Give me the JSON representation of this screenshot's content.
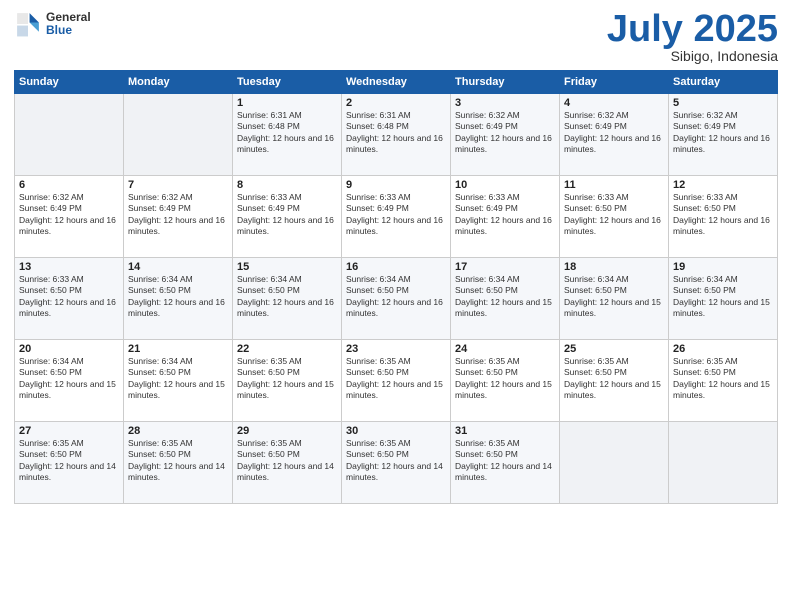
{
  "logo": {
    "general": "General",
    "blue": "Blue"
  },
  "title": "July 2025",
  "subtitle": "Sibigo, Indonesia",
  "days_of_week": [
    "Sunday",
    "Monday",
    "Tuesday",
    "Wednesday",
    "Thursday",
    "Friday",
    "Saturday"
  ],
  "weeks": [
    [
      {
        "day": "",
        "info": ""
      },
      {
        "day": "",
        "info": ""
      },
      {
        "day": "1",
        "info": "Sunrise: 6:31 AM\nSunset: 6:48 PM\nDaylight: 12 hours and 16 minutes."
      },
      {
        "day": "2",
        "info": "Sunrise: 6:31 AM\nSunset: 6:48 PM\nDaylight: 12 hours and 16 minutes."
      },
      {
        "day": "3",
        "info": "Sunrise: 6:32 AM\nSunset: 6:49 PM\nDaylight: 12 hours and 16 minutes."
      },
      {
        "day": "4",
        "info": "Sunrise: 6:32 AM\nSunset: 6:49 PM\nDaylight: 12 hours and 16 minutes."
      },
      {
        "day": "5",
        "info": "Sunrise: 6:32 AM\nSunset: 6:49 PM\nDaylight: 12 hours and 16 minutes."
      }
    ],
    [
      {
        "day": "6",
        "info": "Sunrise: 6:32 AM\nSunset: 6:49 PM\nDaylight: 12 hours and 16 minutes."
      },
      {
        "day": "7",
        "info": "Sunrise: 6:32 AM\nSunset: 6:49 PM\nDaylight: 12 hours and 16 minutes."
      },
      {
        "day": "8",
        "info": "Sunrise: 6:33 AM\nSunset: 6:49 PM\nDaylight: 12 hours and 16 minutes."
      },
      {
        "day": "9",
        "info": "Sunrise: 6:33 AM\nSunset: 6:49 PM\nDaylight: 12 hours and 16 minutes."
      },
      {
        "day": "10",
        "info": "Sunrise: 6:33 AM\nSunset: 6:49 PM\nDaylight: 12 hours and 16 minutes."
      },
      {
        "day": "11",
        "info": "Sunrise: 6:33 AM\nSunset: 6:50 PM\nDaylight: 12 hours and 16 minutes."
      },
      {
        "day": "12",
        "info": "Sunrise: 6:33 AM\nSunset: 6:50 PM\nDaylight: 12 hours and 16 minutes."
      }
    ],
    [
      {
        "day": "13",
        "info": "Sunrise: 6:33 AM\nSunset: 6:50 PM\nDaylight: 12 hours and 16 minutes."
      },
      {
        "day": "14",
        "info": "Sunrise: 6:34 AM\nSunset: 6:50 PM\nDaylight: 12 hours and 16 minutes."
      },
      {
        "day": "15",
        "info": "Sunrise: 6:34 AM\nSunset: 6:50 PM\nDaylight: 12 hours and 16 minutes."
      },
      {
        "day": "16",
        "info": "Sunrise: 6:34 AM\nSunset: 6:50 PM\nDaylight: 12 hours and 16 minutes."
      },
      {
        "day": "17",
        "info": "Sunrise: 6:34 AM\nSunset: 6:50 PM\nDaylight: 12 hours and 15 minutes."
      },
      {
        "day": "18",
        "info": "Sunrise: 6:34 AM\nSunset: 6:50 PM\nDaylight: 12 hours and 15 minutes."
      },
      {
        "day": "19",
        "info": "Sunrise: 6:34 AM\nSunset: 6:50 PM\nDaylight: 12 hours and 15 minutes."
      }
    ],
    [
      {
        "day": "20",
        "info": "Sunrise: 6:34 AM\nSunset: 6:50 PM\nDaylight: 12 hours and 15 minutes."
      },
      {
        "day": "21",
        "info": "Sunrise: 6:34 AM\nSunset: 6:50 PM\nDaylight: 12 hours and 15 minutes."
      },
      {
        "day": "22",
        "info": "Sunrise: 6:35 AM\nSunset: 6:50 PM\nDaylight: 12 hours and 15 minutes."
      },
      {
        "day": "23",
        "info": "Sunrise: 6:35 AM\nSunset: 6:50 PM\nDaylight: 12 hours and 15 minutes."
      },
      {
        "day": "24",
        "info": "Sunrise: 6:35 AM\nSunset: 6:50 PM\nDaylight: 12 hours and 15 minutes."
      },
      {
        "day": "25",
        "info": "Sunrise: 6:35 AM\nSunset: 6:50 PM\nDaylight: 12 hours and 15 minutes."
      },
      {
        "day": "26",
        "info": "Sunrise: 6:35 AM\nSunset: 6:50 PM\nDaylight: 12 hours and 15 minutes."
      }
    ],
    [
      {
        "day": "27",
        "info": "Sunrise: 6:35 AM\nSunset: 6:50 PM\nDaylight: 12 hours and 14 minutes."
      },
      {
        "day": "28",
        "info": "Sunrise: 6:35 AM\nSunset: 6:50 PM\nDaylight: 12 hours and 14 minutes."
      },
      {
        "day": "29",
        "info": "Sunrise: 6:35 AM\nSunset: 6:50 PM\nDaylight: 12 hours and 14 minutes."
      },
      {
        "day": "30",
        "info": "Sunrise: 6:35 AM\nSunset: 6:50 PM\nDaylight: 12 hours and 14 minutes."
      },
      {
        "day": "31",
        "info": "Sunrise: 6:35 AM\nSunset: 6:50 PM\nDaylight: 12 hours and 14 minutes."
      },
      {
        "day": "",
        "info": ""
      },
      {
        "day": "",
        "info": ""
      }
    ]
  ]
}
